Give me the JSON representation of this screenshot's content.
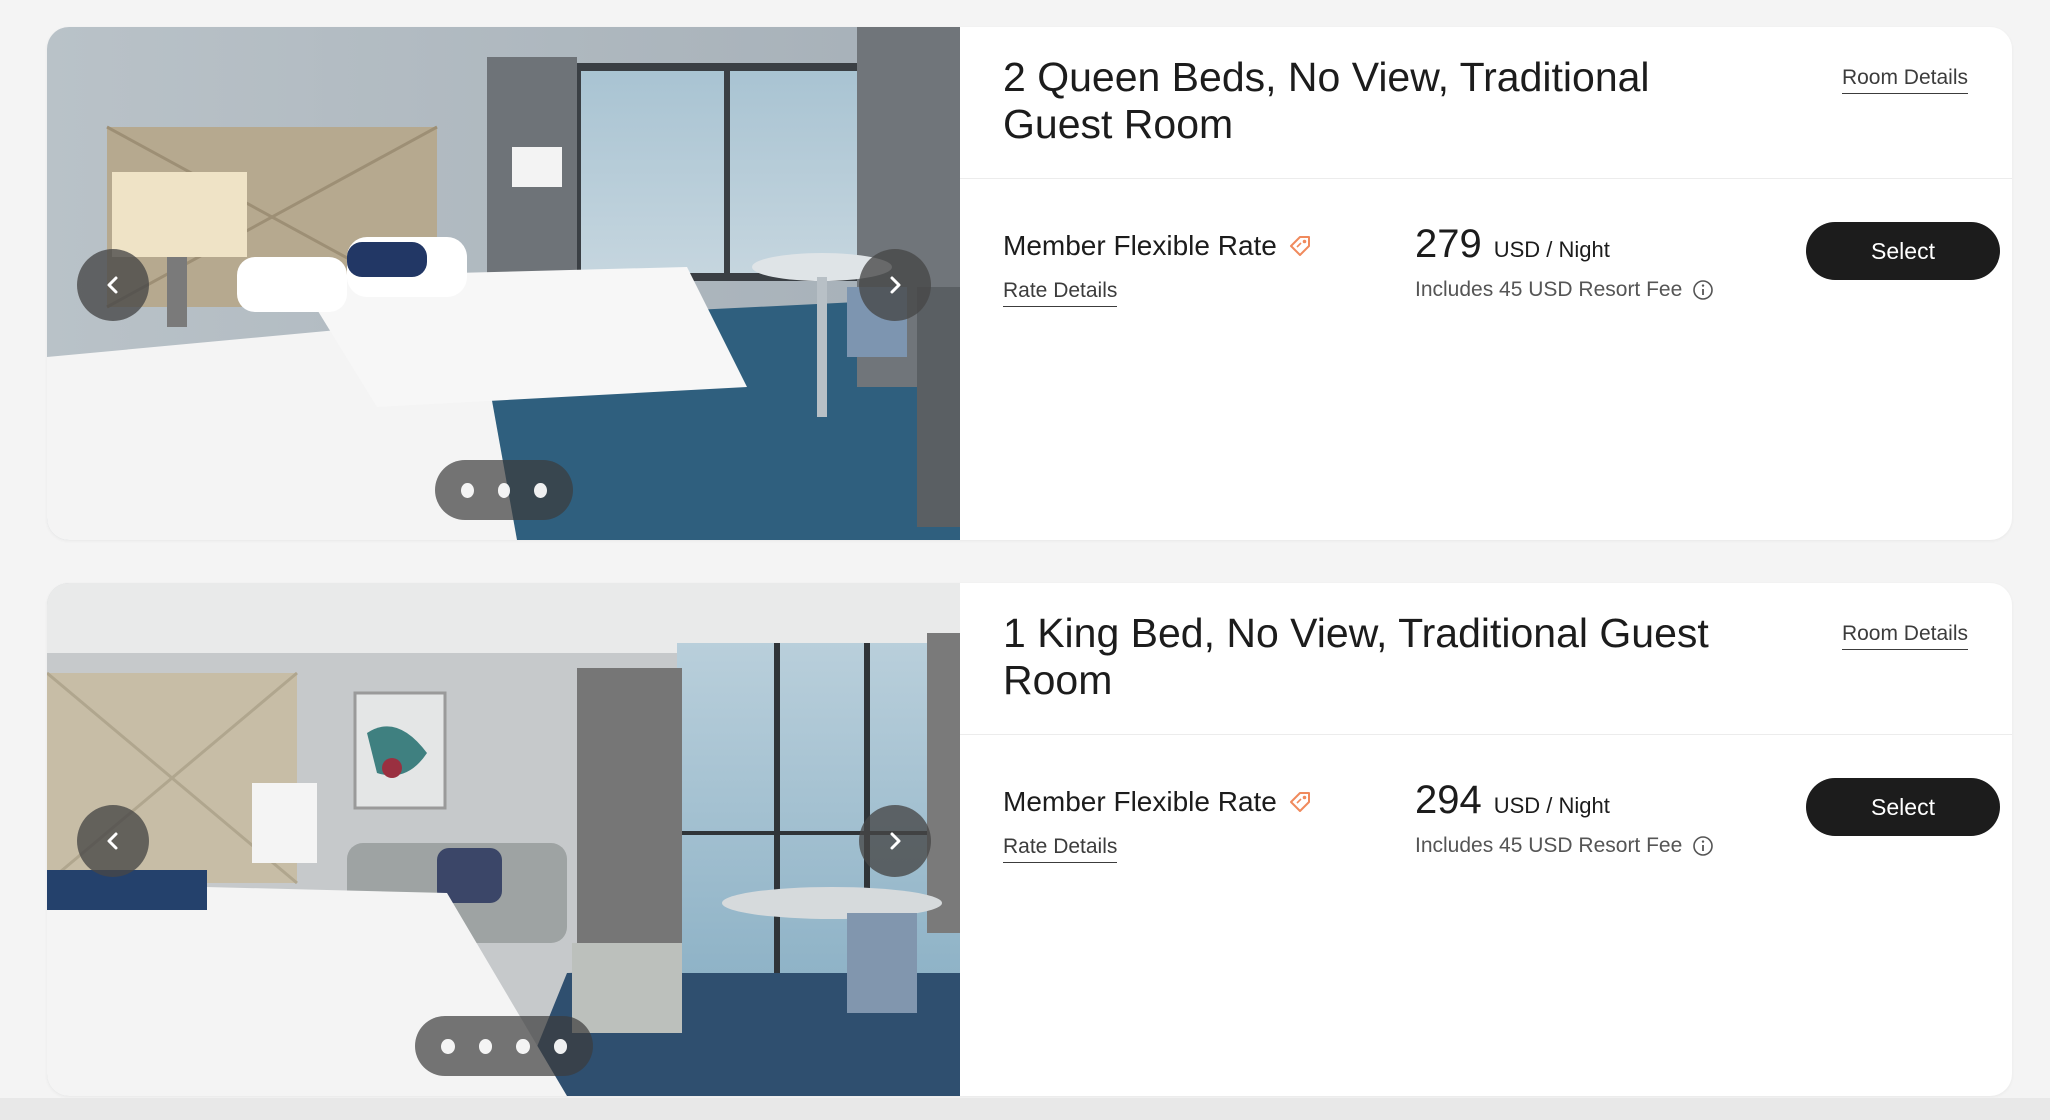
{
  "rooms": [
    {
      "title": "2 Queen Beds, No View, Traditional Guest Room",
      "room_details_label": "Room Details",
      "rate_name": "Member Flexible Rate",
      "rate_details_label": "Rate Details",
      "price": "279",
      "price_unit": "USD / Night",
      "fee_text": "Includes 45 USD Resort Fee",
      "select_label": "Select",
      "photo_count": 3,
      "active_photo": 1
    },
    {
      "title": "1 King Bed, No View, Traditional Guest Room",
      "room_details_label": "Room Details",
      "rate_name": "Member Flexible Rate",
      "rate_details_label": "Rate Details",
      "price": "294",
      "price_unit": "USD / Night",
      "fee_text": "Includes 45 USD Resort Fee",
      "select_label": "Select",
      "photo_count": 4,
      "active_photo": 1
    }
  ],
  "icons": {
    "prev": "chevron-left-icon",
    "next": "chevron-right-icon",
    "rate_tag": "tag-icon",
    "fee_info": "info-icon"
  },
  "colors": {
    "primary_button": "#1c1c1c",
    "tag_accent": "#f08a5d",
    "card_background": "#ffffff",
    "page_background": "#f4f4f4"
  }
}
